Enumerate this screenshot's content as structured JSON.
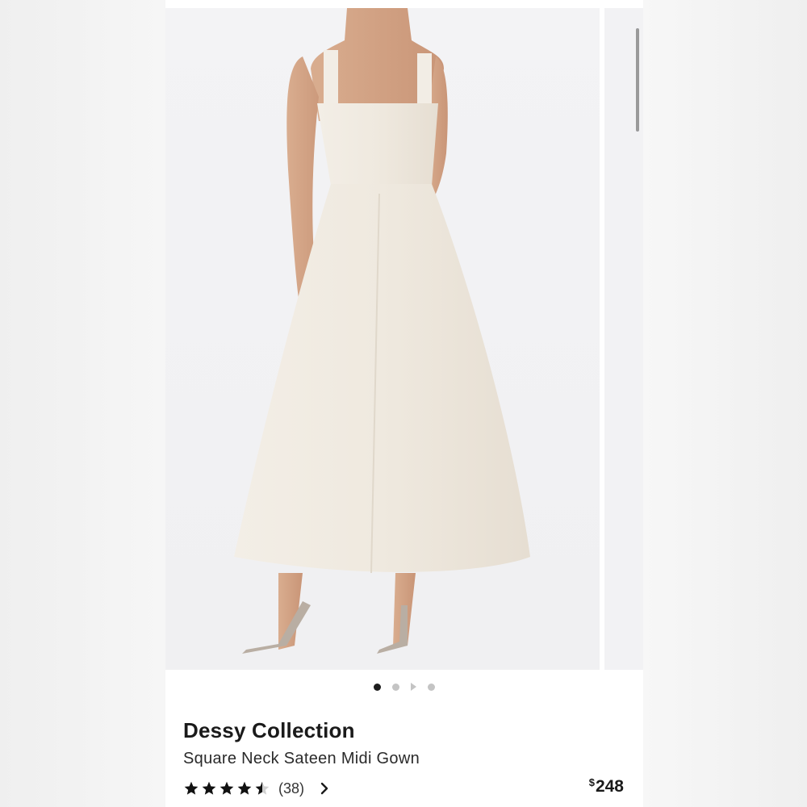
{
  "gallery": {
    "total_images": 4,
    "active_index": 0,
    "dots": [
      "dot",
      "dot",
      "play",
      "dot"
    ]
  },
  "product": {
    "brand": "Dessy Collection",
    "name": "Square Neck Sateen Midi Gown",
    "rating": 4.5,
    "rating_max": 5,
    "review_count": "(38)",
    "price_currency": "$",
    "price_amount": "248"
  },
  "icons": {
    "star": "star-icon",
    "chevron": "chevron-right-icon",
    "play": "play-icon"
  },
  "colors": {
    "text": "#1a1a1a",
    "star_filled": "#111111",
    "star_empty": "#d0d0d0",
    "dot_active": "#1d1d1d",
    "dot_inactive": "#c4c4c4"
  }
}
